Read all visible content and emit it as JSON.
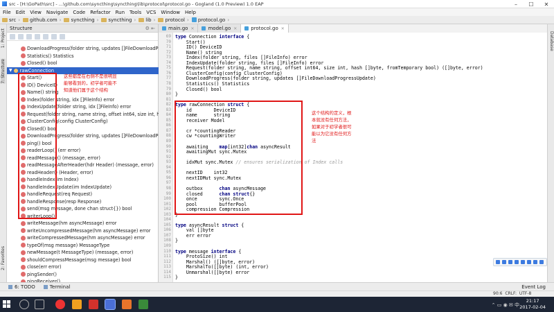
{
  "window": {
    "title": "src - [H:\\GoPath\\src] - ...\\github.com\\syncthing\\syncthing\\lib\\protocol\\protocol.go - Gogland (1.0 Preview) 1.0 EAP"
  },
  "menu": [
    "File",
    "Edit",
    "View",
    "Navigate",
    "Code",
    "Refactor",
    "Run",
    "Tools",
    "VCS",
    "Window",
    "Help"
  ],
  "breadcrumbs": [
    "src",
    "github.com",
    "syncthing",
    "syncthing",
    "lib",
    "protocol",
    "protocol.go"
  ],
  "tabs": [
    {
      "label": "main.go",
      "active": false
    },
    {
      "label": "model.go",
      "active": false
    },
    {
      "label": "protocol.go",
      "active": true
    }
  ],
  "side_labels": {
    "project": "1: Project",
    "structure": "7: Structure",
    "favorites": "2: Favorites",
    "database": "Database"
  },
  "structure_panel": {
    "title": "Structure",
    "top_items": [
      "DownloadProgress(folder string, updates []FileDownloadProgressUpdate)",
      "Statistics() Statistics",
      "Closed() bool"
    ],
    "selected": "rawConnection",
    "members": [
      "Start()",
      "ID() DeviceID",
      "Name() string",
      "Index(folder string, idx []FileInfo) error",
      "IndexUpdate(folder string, idx []FileInfo) error",
      "Request(folder string, name string, offset int64, size int, hash []byte, fromTemporary bool) ([]byte, error)",
      "ClusterConfig(config ClusterConfig)",
      "Closed() bool",
      "DownloadProgress(folder string, updates []FileDownloadProgressUpdate)",
      "ping() bool",
      "readerLoop() (err error)",
      "readMessage() (message, error)",
      "readMessageAfterHeader(hdr Header) (message, error)",
      "readHeader() (Header, error)",
      "handleIndex(im Index)",
      "handleIndexUpdate(im IndexUpdate)",
      "handleRequest(req Request)",
      "handleResponse(resp Response)",
      "send(msg message, done chan struct{}) bool",
      "writerLoop()",
      "writeMessage(hm asyncMessage) error",
      "writeUncompressedMessage(hm asyncMessage) error",
      "writeCompressedMessage(hm asyncMessage) error",
      "typeOf(msg message) MessageType",
      "newMessage(t MessageType) (message, error)",
      "shouldCompressMessage(msg message) bool",
      "close(err error)",
      "pingSender()",
      "pingReceiver()"
    ]
  },
  "annotations": {
    "left": [
      "这些都是在右侧不是很明显",
      "能够看到的，初学者可能不",
      "知道他们属于这个结构"
    ],
    "right": [
      "这个结构的定义，根",
      "本就没有任何方法，",
      "如果对于初学者很可",
      "能以为它没有任何方",
      "法"
    ]
  },
  "editor": {
    "lines": [
      {
        "n": "69",
        "t": "type Connection interface {"
      },
      {
        "n": "70",
        "t": "    Start()"
      },
      {
        "n": "71",
        "t": "    ID() DeviceID"
      },
      {
        "n": "72",
        "t": "    Name() string"
      },
      {
        "n": "73",
        "t": "    Index(folder string, files []FileInfo) error"
      },
      {
        "n": "74",
        "t": "    IndexUpdate(folder string, files []FileInfo) error"
      },
      {
        "n": "75",
        "t": "    Request(folder string, name string, offset int64, size int, hash []byte, fromTemporary bool) ([]byte, error)"
      },
      {
        "n": "76",
        "t": "    ClusterConfig(config ClusterConfig)"
      },
      {
        "n": "77",
        "t": "    DownloadProgress(folder string, updates []FileDownloadProgressUpdate)"
      },
      {
        "n": "78",
        "t": "    Statistics() Statistics"
      },
      {
        "n": "79",
        "t": "    Closed() bool"
      },
      {
        "n": "80",
        "t": "}"
      },
      {
        "n": "81",
        "t": ""
      },
      {
        "n": "82",
        "t": "type rawConnection struct {"
      },
      {
        "n": "83",
        "t": "    id        DeviceID"
      },
      {
        "n": "84",
        "t": "    name      string"
      },
      {
        "n": "85",
        "t": "    receiver Model"
      },
      {
        "n": "86",
        "t": ""
      },
      {
        "n": "87",
        "t": "    cr *countingReader"
      },
      {
        "n": "88",
        "t": "    cw *countingWriter"
      },
      {
        "n": "89",
        "t": ""
      },
      {
        "n": "90",
        "t": "    awaiting    map[int32]chan asyncResult"
      },
      {
        "n": "91",
        "t": "    awaitingMut sync.Mutex"
      },
      {
        "n": "92",
        "t": ""
      },
      {
        "n": "93",
        "t": "    idxMut sync.Mutex // ensures serialization of Index calls"
      },
      {
        "n": "94",
        "t": ""
      },
      {
        "n": "95",
        "t": "    nextID    int32"
      },
      {
        "n": "96",
        "t": "    nextIDMut sync.Mutex"
      },
      {
        "n": "97",
        "t": ""
      },
      {
        "n": "98",
        "t": "    outbox      chan asyncMessage"
      },
      {
        "n": "99",
        "t": "    closed      chan struct{}"
      },
      {
        "n": "100",
        "t": "    once        sync.Once"
      },
      {
        "n": "101",
        "t": "    pool        bufferPool"
      },
      {
        "n": "102",
        "t": "    compression Compression"
      },
      {
        "n": "103",
        "t": "}"
      },
      {
        "n": "104",
        "t": ""
      },
      {
        "n": "105",
        "t": "type asyncResult struct {"
      },
      {
        "n": "106",
        "t": "    val []byte"
      },
      {
        "n": "107",
        "t": "    err error"
      },
      {
        "n": "108",
        "t": "}"
      },
      {
        "n": "109",
        "t": ""
      },
      {
        "n": "110",
        "t": "type message interface {"
      },
      {
        "n": "111",
        "t": "    ProtoSize() int"
      },
      {
        "n": "112",
        "t": "    Marshal() ([]byte, error)"
      },
      {
        "n": "113",
        "t": "    MarshalTo([]byte) (int, error)"
      },
      {
        "n": "114",
        "t": "    Unmarshal([]byte) error"
      },
      {
        "n": "115",
        "t": "}"
      }
    ]
  },
  "bottom_tabs": [
    "6: TODO",
    "Terminal"
  ],
  "event_log": "Event Log",
  "status": {
    "position": "90:6",
    "line_sep": "CRLF:",
    "encoding": "UTF-8"
  },
  "clock": {
    "time": "21:17",
    "date": "2017-02-04"
  },
  "colors": {
    "selection": "#2f65ca",
    "annotation_red": "#e01515",
    "keyword_blue": "#000080"
  }
}
